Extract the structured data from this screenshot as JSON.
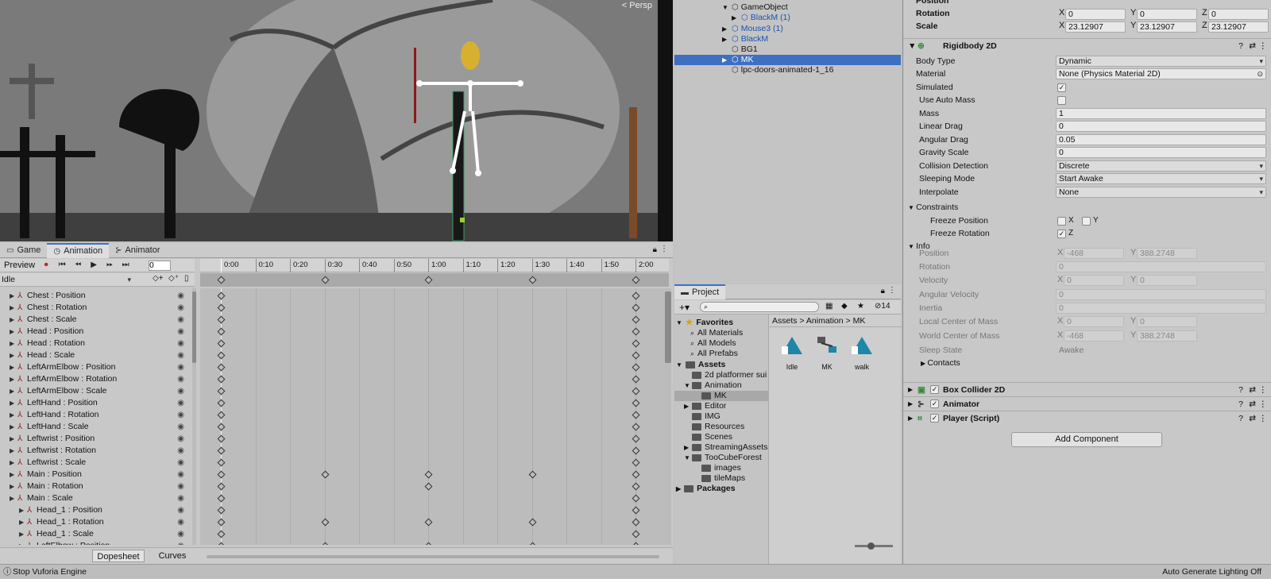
{
  "scene": {
    "persp_label": "< Persp"
  },
  "anim_tabs": [
    {
      "label": "Game"
    },
    {
      "label": "Animation"
    },
    {
      "label": "Animator"
    }
  ],
  "anim_toolbar": {
    "preview": "Preview",
    "frame": "0",
    "clip": "Idle"
  },
  "timeline_labels": [
    "0:00",
    "0:10",
    "0:20",
    "0:30",
    "0:40",
    "0:50",
    "1:00",
    "1:10",
    "1:20",
    "1:30",
    "1:40",
    "1:50",
    "2:00"
  ],
  "properties": [
    "Chest : Position",
    "Chest : Rotation",
    "Chest : Scale",
    "Head : Position",
    "Head : Rotation",
    "Head : Scale",
    "LeftArmElbow : Position",
    "LeftArmElbow : Rotation",
    "LeftArmElbow : Scale",
    "LeftHand : Position",
    "LeftHand : Rotation",
    "LeftHand : Scale",
    "Leftwrist : Position",
    "Leftwrist : Rotation",
    "Leftwrist : Scale",
    "Main : Position",
    "Main : Rotation",
    "Main : Scale",
    "Head_1 : Position",
    "Head_1 : Rotation",
    "Head_1 : Scale",
    "LeftElbow : Position"
  ],
  "anim_bottom": {
    "dopesheet": "Dopesheet",
    "curves": "Curves"
  },
  "hierarchy": [
    {
      "label": "GameObject",
      "indent": 0,
      "blue": false
    },
    {
      "label": "BlackM (1)",
      "indent": 1,
      "blue": true
    },
    {
      "label": "Mouse3 (1)",
      "indent": 0,
      "blue": true
    },
    {
      "label": "BlackM",
      "indent": 0,
      "blue": true
    },
    {
      "label": "BG1",
      "indent": 0,
      "blue": false
    },
    {
      "label": "MK",
      "indent": 0,
      "blue": false
    },
    {
      "label": "lpc-doors-animated-1_16",
      "indent": 0,
      "blue": false
    }
  ],
  "project": {
    "tab": "Project",
    "count": "14",
    "breadcrumb": [
      "Assets",
      "Animation",
      "MK"
    ],
    "favorites": {
      "label": "Favorites",
      "items": [
        "All Materials",
        "All Models",
        "All Prefabs"
      ]
    },
    "assets_label": "Assets",
    "tree": [
      "2d platformer sui",
      "Animation",
      "MK",
      "Editor",
      "IMG",
      "Resources",
      "Scenes",
      "StreamingAssets",
      "TooCubeForest",
      "images",
      "tileMaps"
    ],
    "packages": "Packages",
    "files": [
      "Idle",
      "MK",
      "walk"
    ]
  },
  "inspector": {
    "top": {
      "position": "Position",
      "rotation": "Rotation",
      "scale": "Scale",
      "rot": [
        "0",
        "0",
        "0"
      ],
      "scl": [
        "23.12907",
        "23.12907",
        "23.12907"
      ]
    },
    "rigidbody": {
      "title": "Rigidbody 2D",
      "body_type_label": "Body Type",
      "body_type": "Dynamic",
      "material_label": "Material",
      "material": "None (Physics Material 2D)",
      "simulated": "Simulated",
      "use_auto_mass": "Use Auto Mass",
      "mass_label": "Mass",
      "mass": "1",
      "linear_drag_label": "Linear Drag",
      "linear_drag": "0",
      "angular_drag_label": "Angular Drag",
      "angular_drag": "0.05",
      "gravity_label": "Gravity Scale",
      "gravity": "0",
      "collision_label": "Collision Detection",
      "collision": "Discrete",
      "sleeping_label": "Sleeping Mode",
      "sleeping": "Start Awake",
      "interpolate_label": "Interpolate",
      "interpolate": "None",
      "constraints": "Constraints",
      "freeze_pos": "Freeze Position",
      "freeze_rot": "Freeze Rotation",
      "info": "Info",
      "info_position": "Position",
      "pos_x": "-468",
      "pos_y": "388.2748",
      "info_rotation": "Rotation",
      "rot_val": "0",
      "velocity": "Velocity",
      "vel_x": "0",
      "vel_y": "0",
      "ang_vel": "Angular Velocity",
      "ang_vel_val": "0",
      "inertia": "Inertia",
      "inertia_val": "0",
      "local_com": "Local Center of Mass",
      "lc_x": "0",
      "lc_y": "0",
      "world_com": "World Center of Mass",
      "wc_x": "-468",
      "wc_y": "388.2748",
      "sleep_state": "Sleep State",
      "sleep_state_val": "Awake",
      "contacts": "Contacts"
    },
    "components": [
      "Box Collider 2D",
      "Animator",
      "Player (Script)"
    ],
    "add_component": "Add Component"
  },
  "status": {
    "left": "Stop Vuforia Engine",
    "right": "Auto Generate Lighting Off"
  }
}
